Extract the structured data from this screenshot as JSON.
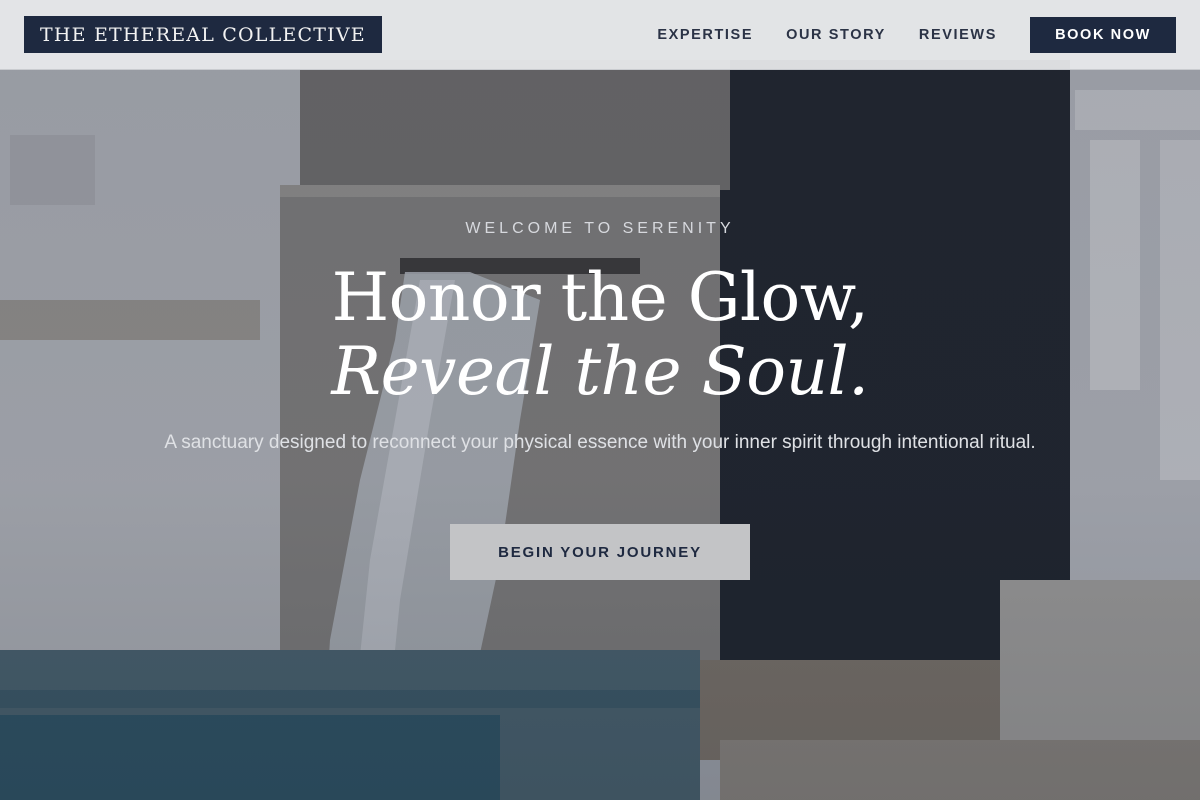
{
  "header": {
    "logo": "THE ETHEREAL COLLECTIVE",
    "nav": [
      {
        "label": "EXPERTISE"
      },
      {
        "label": "OUR STORY"
      },
      {
        "label": "REVIEWS"
      }
    ],
    "book_button": "BOOK NOW"
  },
  "hero": {
    "eyebrow": "WELCOME TO SERENITY",
    "headline_line1": "Honor the Glow,",
    "headline_line2": "Reveal the Soul.",
    "subtitle": "A sanctuary designed to reconnect your physical essence with your inner spirit through intentional ritual.",
    "cta": "BEGIN YOUR JOURNEY",
    "background_image": "waterfall-fountain-photo"
  },
  "colors": {
    "navy": "#1e2940",
    "header_bg": "#e8e9eb",
    "cta_bg": "#c3c4c6",
    "text_light": "#ffffff"
  }
}
